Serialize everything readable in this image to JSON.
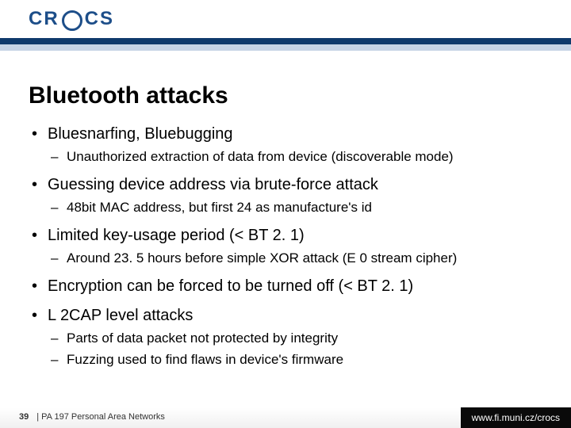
{
  "header": {
    "logo_left": "CR",
    "logo_right": "CS"
  },
  "title": "Bluetooth attacks",
  "bullets": [
    {
      "text": "Bluesnarfing, Bluebugging",
      "sub": [
        "Unauthorized extraction of data from device (discoverable mode)"
      ]
    },
    {
      "text": "Guessing device address via brute-force attack",
      "sub": [
        "48bit MAC address, but first 24 as manufacture's id"
      ]
    },
    {
      "text": "Limited key-usage period (< BT 2. 1)",
      "sub": [
        "Around 23. 5 hours before simple XOR attack (E 0 stream cipher)"
      ]
    },
    {
      "text": "Encryption can be forced to be turned off (< BT 2. 1)",
      "sub": []
    },
    {
      "text": "L 2CAP level attacks",
      "sub": [
        "Parts of data packet not protected by integrity",
        "Fuzzing used to find flaws in device's firmware"
      ]
    }
  ],
  "footer": {
    "page": "39",
    "course": "| PA 197 Personal Area Networks",
    "site": "www.fi.muni.cz/crocs"
  }
}
